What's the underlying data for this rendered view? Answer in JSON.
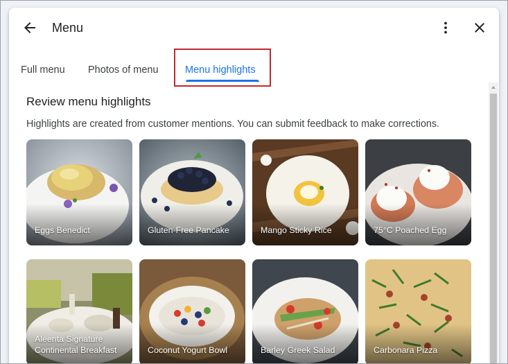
{
  "header": {
    "title": "Menu"
  },
  "tabs": [
    {
      "label": "Full menu"
    },
    {
      "label": "Photos of menu"
    },
    {
      "label": "Menu highlights"
    }
  ],
  "section": {
    "title": "Review menu highlights",
    "description": "Highlights are created from customer mentions. You can submit feedback to make corrections."
  },
  "items": [
    {
      "name": "Eggs Benedict"
    },
    {
      "name": "Gluten-Free Pancake"
    },
    {
      "name": "Mango Sticky Rice"
    },
    {
      "name": "75°C Poached Egg"
    },
    {
      "name": "Aleenta Signature Continental Breakfast"
    },
    {
      "name": "Coconut Yogurt Bowl"
    },
    {
      "name": "Barley Greek Salad"
    },
    {
      "name": "Carbonara Pizza"
    }
  ],
  "colors": {
    "accent": "#1a73e8",
    "highlight_box": "#c2272d"
  },
  "icons": [
    "arrow-back-icon",
    "more-vert-icon",
    "close-icon",
    "scroll-up-icon"
  ]
}
